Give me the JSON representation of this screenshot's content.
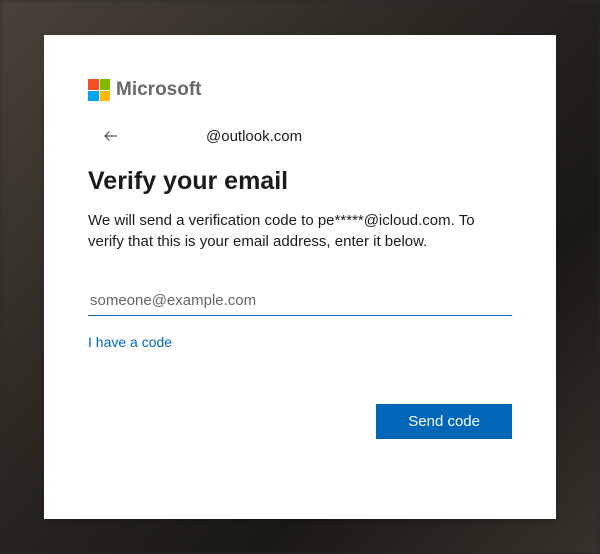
{
  "logo": {
    "brand": "Microsoft"
  },
  "account": {
    "email": "@outlook.com"
  },
  "title": "Verify your email",
  "instruction": "We will send a verification code to pe*****@icloud.com. To verify that this is your email address, enter it below.",
  "input": {
    "placeholder": "someone@example.com",
    "value": ""
  },
  "links": {
    "have_code": "I have a code"
  },
  "buttons": {
    "send": "Send code"
  },
  "colors": {
    "primary": "#0067b8",
    "ms_red": "#f25022",
    "ms_green": "#7fba00",
    "ms_blue": "#00a4ef",
    "ms_yellow": "#ffb900"
  }
}
